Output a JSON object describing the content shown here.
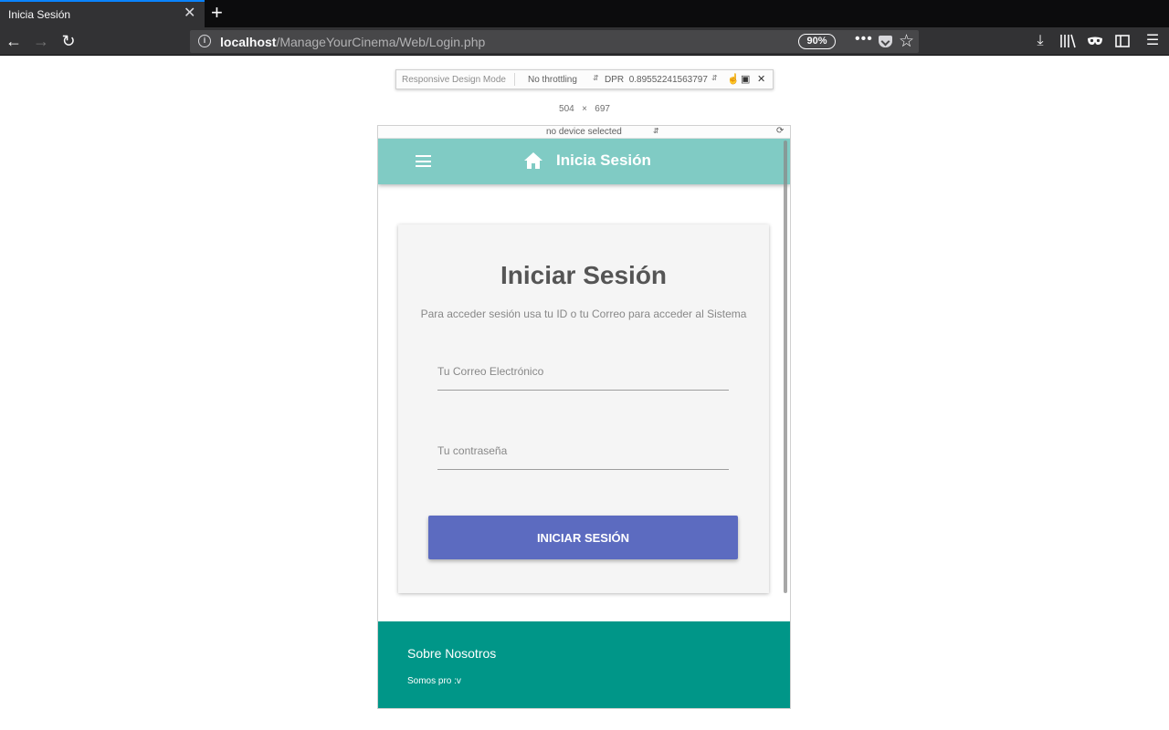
{
  "browser": {
    "tab_title": "Inicia Sesión",
    "tab_close": "✕",
    "new_tab": "+",
    "url_host": "localhost",
    "url_path": "/ManageYourCinema/Web/Login.php",
    "zoom": "90%",
    "page_actions": "•••",
    "icons": [
      "back-icon",
      "forward-icon",
      "reload-icon",
      "info-icon",
      "pocket-icon",
      "star-icon",
      "download-icon",
      "library-icon",
      "private-mask-icon",
      "sidebar-icon",
      "menu-icon"
    ]
  },
  "rdm": {
    "label": "Responsive Design Mode",
    "throttling": "No throttling",
    "dpr_label": "DPR",
    "dpr_value": "0.89552241563797",
    "viewport_width": "504",
    "viewport_times": "×",
    "viewport_height": "697",
    "device": "no device selected"
  },
  "app": {
    "header_title": "Inicia Sesión",
    "header_color": "#80cbc4",
    "card_title": "Iniciar Sesión",
    "card_subtitle": "Para acceder sesión usa tu ID o tu Correo para acceder al Sistema",
    "email_placeholder": "Tu Correo Electrónico",
    "password_placeholder": "Tu contraseña",
    "login_button": "INICIAR SESIÓN",
    "button_color": "#5c6bc0",
    "footer_title": "Sobre Nosotros",
    "footer_text": "Somos pro :v",
    "footer_color": "#009688"
  }
}
